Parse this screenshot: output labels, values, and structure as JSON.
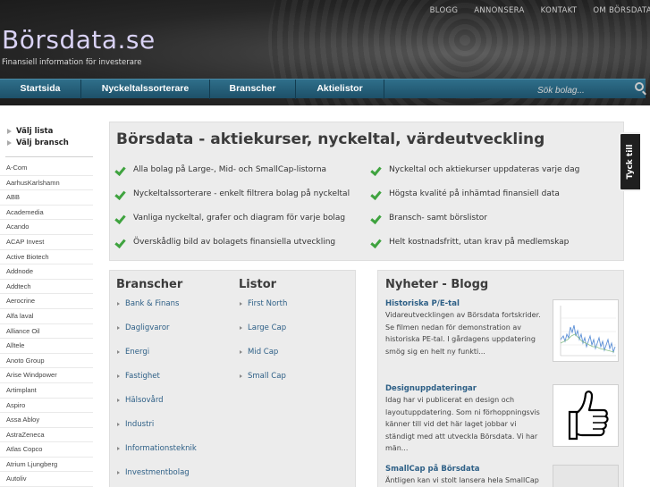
{
  "header": {
    "top_links": [
      "BLOGG",
      "ANNONSERA",
      "KONTAKT",
      "OM BÖRSDATA"
    ],
    "logo": "Börsdata.se",
    "tagline": "Finansiell information för investerare"
  },
  "main_nav": {
    "items": [
      "Startsida",
      "Nyckeltalssorterare",
      "Branscher",
      "Aktielistor"
    ],
    "search_placeholder": "Sök bolag..."
  },
  "sidebar": {
    "links": [
      "Välj lista",
      "Välj bransch"
    ],
    "companies": [
      "A-Com",
      "AarhusKarlshamn",
      "ABB",
      "Academedia",
      "Acando",
      "ACAP Invest",
      "Active Biotech",
      "Addnode",
      "Addtech",
      "Aerocrine",
      "Alfa laval",
      "Alliance Oil",
      "Alltele",
      "Anoto Group",
      "Arise Windpower",
      "Artimplant",
      "Aspiro",
      "Assa Abloy",
      "AstraZeneca",
      "Atlas Copco",
      "Atrium Ljungberg",
      "Autoliv"
    ]
  },
  "hero": {
    "title": "Börsdata - aktiekurser, nyckeltal, värdeutveckling",
    "features": [
      "Alla bolag på Large-, Mid- och SmallCap-listorna",
      "Nyckeltalssorterare - enkelt filtrera bolag på nyckeltal",
      "Vanliga nyckeltal, grafer och diagram för varje bolag",
      "Överskådlig bild av bolagets finansiella utveckling",
      "Nyckeltal och aktiekurser uppdateras varje dag",
      "Högsta kvalité på inhämtad finansiell data",
      "Bransch- samt börslistor",
      "Helt kostnadsfritt, utan krav på medlemskap"
    ]
  },
  "feedback_tab": "Tyck till",
  "branscher": {
    "heading": "Branscher",
    "items": [
      "Bank & Finans",
      "Dagligvaror",
      "Energi",
      "Fastighet",
      "Hälsovård",
      "Industri",
      "Informationsteknik",
      "Investmentbolag"
    ]
  },
  "listor": {
    "heading": "Listor",
    "items": [
      "First North",
      "Large Cap",
      "Mid Cap",
      "Small Cap"
    ]
  },
  "news": {
    "heading": "Nyheter - Blogg",
    "posts": [
      {
        "title": "Historiska P/E-tal",
        "body": "Vidareutvecklingen av Börsdata fortskrider. Se filmen nedan för demonstration av historiska PE-tal. I gårdagens uppdatering smög sig en helt ny funkti...",
        "thumb_icon": "pe-chart-thumbnail"
      },
      {
        "title": "Designuppdateringar",
        "body": "Idag har vi publicerat en design och layoutuppdatering. Som ni förhoppningsvis känner till vid det här laget jobbar vi ständigt med att utveckla Börsdata. Vi har män...",
        "thumb_icon": "thumbs-up-icon"
      },
      {
        "title": "SmallCap på Börsdata",
        "body": "Äntligen kan vi stolt lansera hela SmallCap",
        "thumb_icon": "smallcap-thumbnail"
      }
    ]
  },
  "colors": {
    "nav_bar": "#1d5069",
    "logo": "#d9d2f5",
    "check": "#3fa33f",
    "link": "#2d5f86"
  }
}
